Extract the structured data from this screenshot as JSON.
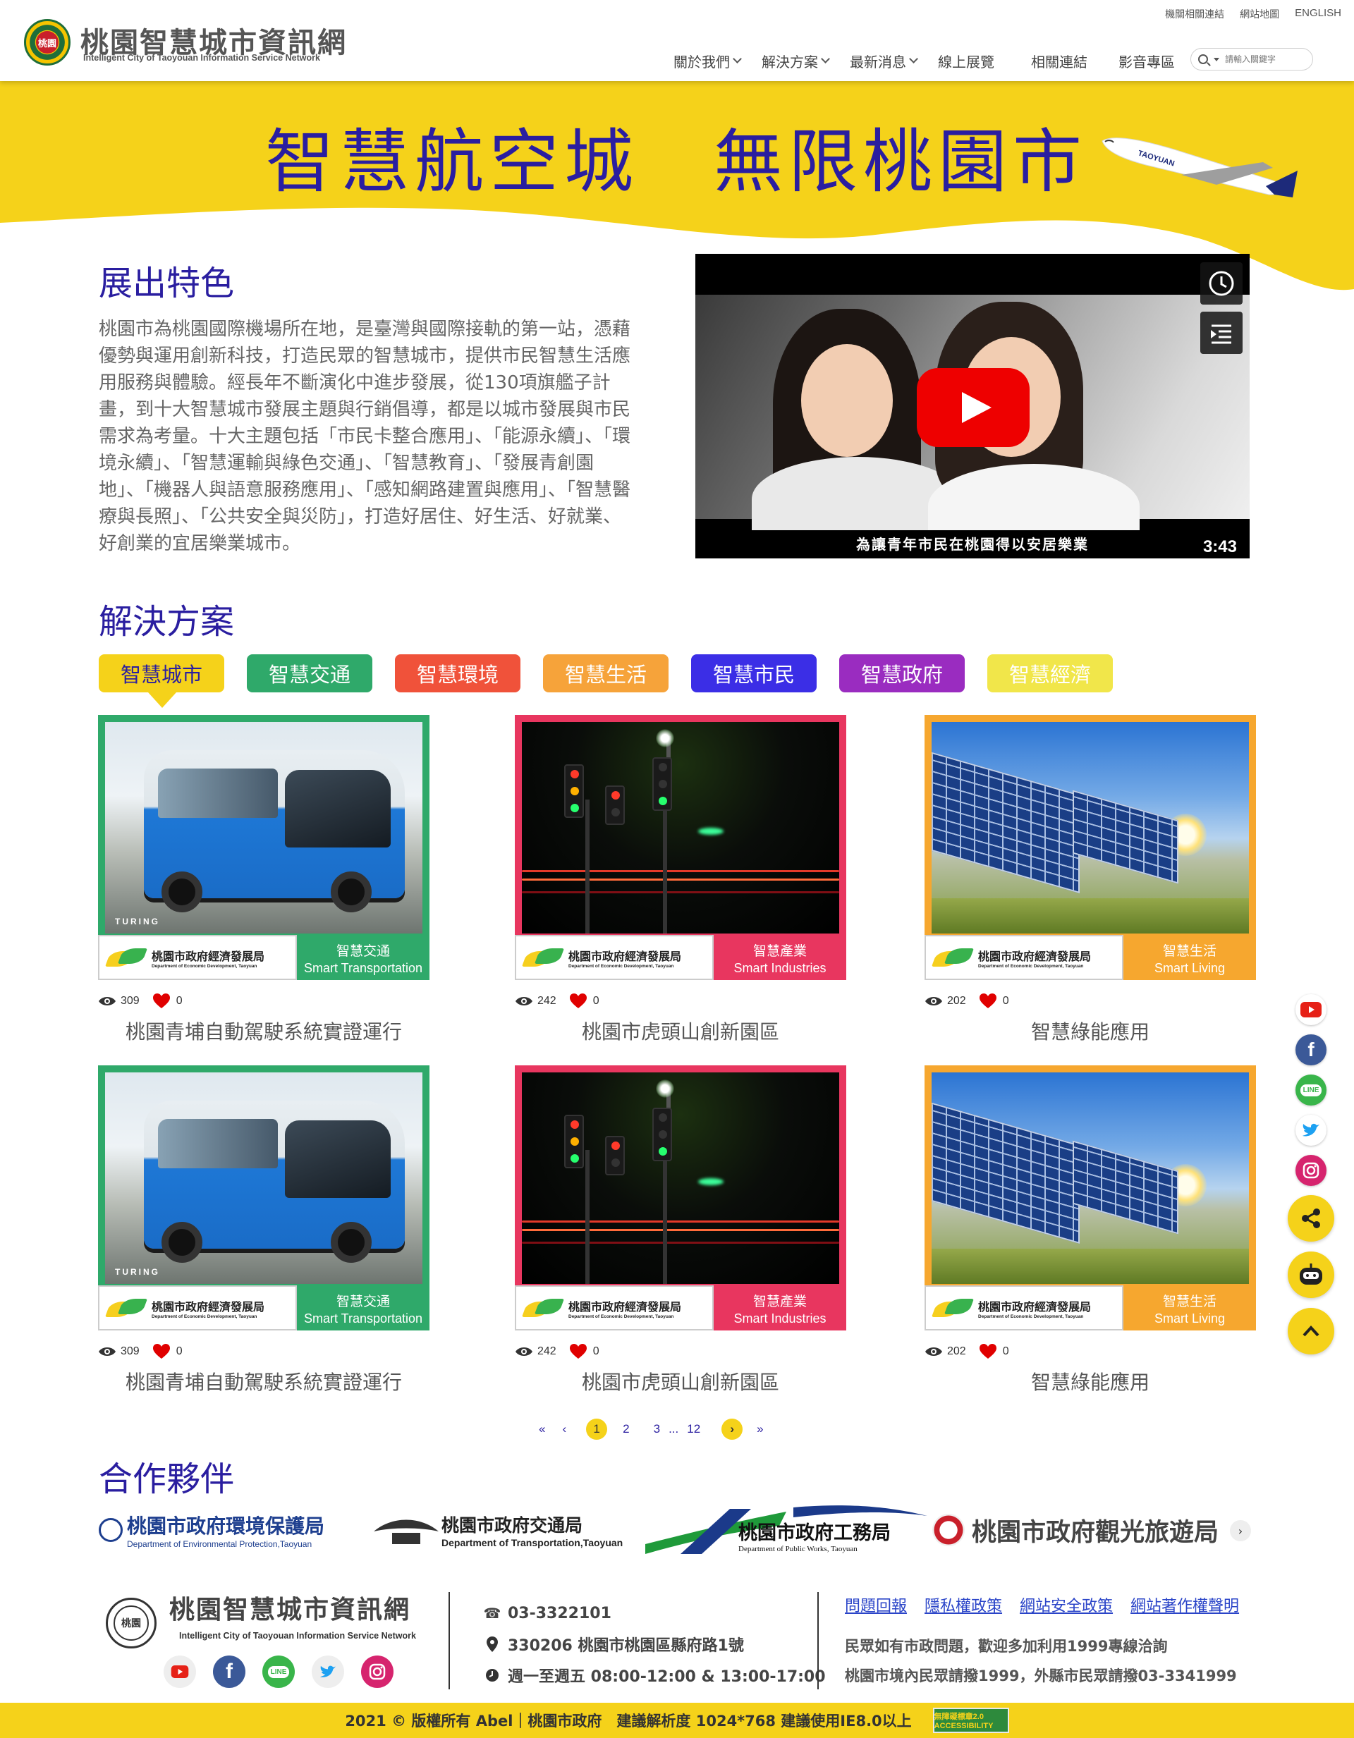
{
  "site": {
    "title": "桃園智慧城市資訊網",
    "subtitle": "Intelligent City of Taoyouan Information Service Network",
    "emblem_text": "桃園"
  },
  "util_links": [
    "機關相關連結",
    "網站地圖",
    "ENGLISH"
  ],
  "nav": [
    {
      "label": "關於我們",
      "has_dropdown": true
    },
    {
      "label": "解決方案",
      "has_dropdown": true
    },
    {
      "label": "最新消息",
      "has_dropdown": true
    },
    {
      "label": "線上展覽",
      "has_dropdown": false
    },
    {
      "label": "相關連結",
      "has_dropdown": false
    },
    {
      "label": "影音專區",
      "has_dropdown": false
    }
  ],
  "search": {
    "placeholder": "請輸入關鍵字"
  },
  "banner": {
    "slogan": "智慧航空城　無限桃園市",
    "plane_text": "TAOYUAN"
  },
  "intro": {
    "title": "展出特色",
    "text": "桃園市為桃園國際機場所在地，是臺灣與國際接軌的第一站，憑藉優勢與運用創新科技，打造民眾的智慧城市，提供市民智慧生活應用服務與體驗。經長年不斷演化中進步發展，從130項旗艦子計畫，到十大智慧城市發展主題與行銷倡導，都是以城市發展與市民需求為考量。十大主題包括「市民卡整合應用」、「能源永續」、「環境永續」、「智慧運輸與綠色交通」、「智慧教育」、「發展青創園地」、「機器人與語意服務應用」、「感知網路建置與應用」、「智慧醫療與長照」、「公共安全與災防」，打造好居住、好生活、好就業、好創業的宜居樂業城市。"
  },
  "video": {
    "caption": "為讓青年市民在桃園得以安居樂業",
    "duration": "3:43"
  },
  "solutions": {
    "title": "解決方案",
    "tabs": [
      {
        "label": "智慧城市",
        "color": "#f5d21a",
        "active": true
      },
      {
        "label": "智慧交通",
        "color": "#2fa96a",
        "active": false
      },
      {
        "label": "智慧環境",
        "color": "#f0523a",
        "active": false
      },
      {
        "label": "智慧生活",
        "color": "#f6a33a",
        "active": false
      },
      {
        "label": "智慧市民",
        "color": "#3b2ee6",
        "active": false
      },
      {
        "label": "智慧政府",
        "color": "#9a2cc0",
        "active": false
      },
      {
        "label": "智慧經濟",
        "color": "#f1e64a",
        "active": false
      }
    ],
    "cards": [
      {
        "title": "桃園青埔自動駕駛系統實證運行",
        "views": "309",
        "likes": "0",
        "cat_zh": "智慧交通",
        "cat_en": "Smart Transportation",
        "color": "#2fa96a",
        "image": "bus"
      },
      {
        "title": "桃園市虎頭山創新園區",
        "views": "242",
        "likes": "0",
        "cat_zh": "智慧產業",
        "cat_en": "Smart Industries",
        "color": "#e8365f",
        "image": "night"
      },
      {
        "title": "智慧綠能應用",
        "views": "202",
        "likes": "0",
        "cat_zh": "智慧生活",
        "cat_en": "Smart Living",
        "color": "#f6a72f",
        "image": "solar"
      },
      {
        "title": "桃園青埔自動駕駛系統實證運行",
        "views": "309",
        "likes": "0",
        "cat_zh": "智慧交通",
        "cat_en": "Smart Transportation",
        "color": "#2fa96a",
        "image": "bus"
      },
      {
        "title": "桃園市虎頭山創新園區",
        "views": "242",
        "likes": "0",
        "cat_zh": "智慧產業",
        "cat_en": "Smart Industries",
        "color": "#e8365f",
        "image": "night"
      },
      {
        "title": "智慧綠能應用",
        "views": "202",
        "likes": "0",
        "cat_zh": "智慧生活",
        "cat_en": "Smart Living",
        "color": "#f6a72f",
        "image": "solar"
      }
    ],
    "dept": {
      "name": "桃園市政府經濟發展局",
      "en": "Department of Economic Development, Taoyuan"
    },
    "turing_tag": "TURING"
  },
  "pagination": {
    "pages": [
      "1",
      "2",
      "3",
      "...",
      "12"
    ],
    "current": "1"
  },
  "partners": {
    "title": "合作夥伴",
    "items": [
      {
        "name": "桃園市政府環境保護局",
        "en": "Department of Environmental Protection,Taoyuan",
        "color": "#1e3f8f"
      },
      {
        "name": "桃園市政府交通局",
        "en": "Department of Transportation,Taoyuan",
        "color": "#222222"
      },
      {
        "name": "桃園市政府工務局",
        "en": "Department of Public Works, Taoyuan",
        "color": "#1b3a8a"
      },
      {
        "name": "桃園市政府觀光旅遊局",
        "en": "",
        "color": "#444444"
      }
    ]
  },
  "footer": {
    "phone": "03-3322101",
    "address": "330206 桃園市桃園區縣府路1號",
    "hours": "週一至週五 08:00-12:00 & 13:00-17:00",
    "links": [
      "問題回報",
      "隱私權政策",
      "網站安全政策",
      "網站著作權聲明"
    ],
    "note1": "民眾如有市政問題，歡迎多加利用1999專線洽詢",
    "note2": "桃園市境內民眾請撥1999，外縣市民眾請撥03-3341999",
    "copyright": "2021 © 版權所有 Abel｜桃園市政府　建議解析度 1024*768 建議使用IE8.0以上",
    "badge": "無障礙標章2.0 ACCESSIBILITY"
  },
  "social_colors": {
    "youtube": "#e62117",
    "facebook": "#3b5998",
    "line": "#39b54a",
    "twitter": "#1da1f2",
    "instagram": "#d6246e",
    "accent": "#f5d21a"
  },
  "icons": [
    "search-icon",
    "youtube-icon",
    "facebook-icon",
    "line-icon",
    "twitter-icon",
    "instagram-icon",
    "share-icon",
    "robot-icon",
    "chevron-up-icon",
    "eye-icon",
    "heart-icon",
    "phone-icon",
    "location-icon",
    "clock-icon"
  ]
}
